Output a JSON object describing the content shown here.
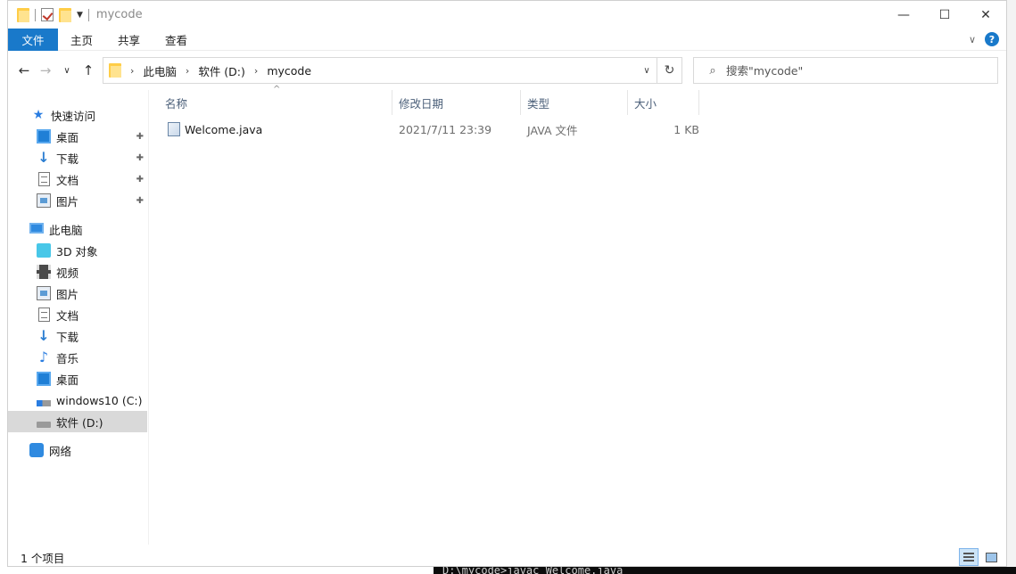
{
  "window": {
    "title": "mycode"
  },
  "ribbon": {
    "tabs": [
      "文件",
      "主页",
      "共享",
      "查看"
    ]
  },
  "address": {
    "crumbs": [
      "此电脑",
      "软件 (D:)",
      "mycode"
    ]
  },
  "search": {
    "placeholder": "搜索\"mycode\""
  },
  "sidebar": {
    "quick_access": "快速访问",
    "quick_items": [
      "桌面",
      "下载",
      "文档",
      "图片"
    ],
    "this_pc": "此电脑",
    "pc_items": [
      "3D 对象",
      "视频",
      "图片",
      "文档",
      "下载",
      "音乐",
      "桌面",
      "windows10 (C:)",
      "软件 (D:)"
    ],
    "network": "网络",
    "selected": "软件 (D:)"
  },
  "columns": {
    "name": "名称",
    "modified": "修改日期",
    "type": "类型",
    "size": "大小"
  },
  "files": [
    {
      "name": "Welcome.java",
      "modified": "2021/7/11 23:39",
      "type": "JAVA 文件",
      "size": "1 KB"
    }
  ],
  "status": {
    "item_count": "1 个项目"
  },
  "background": {
    "terminal_line": "D:\\mycode>javac Welcome.java"
  },
  "colors": {
    "accent": "#1979ca",
    "selected_bg": "#d9d9d9",
    "header_text": "#4c607a"
  },
  "icons": {
    "file_icon": "java-file-icon",
    "sort_indicator": "sort-ascending-caret"
  }
}
